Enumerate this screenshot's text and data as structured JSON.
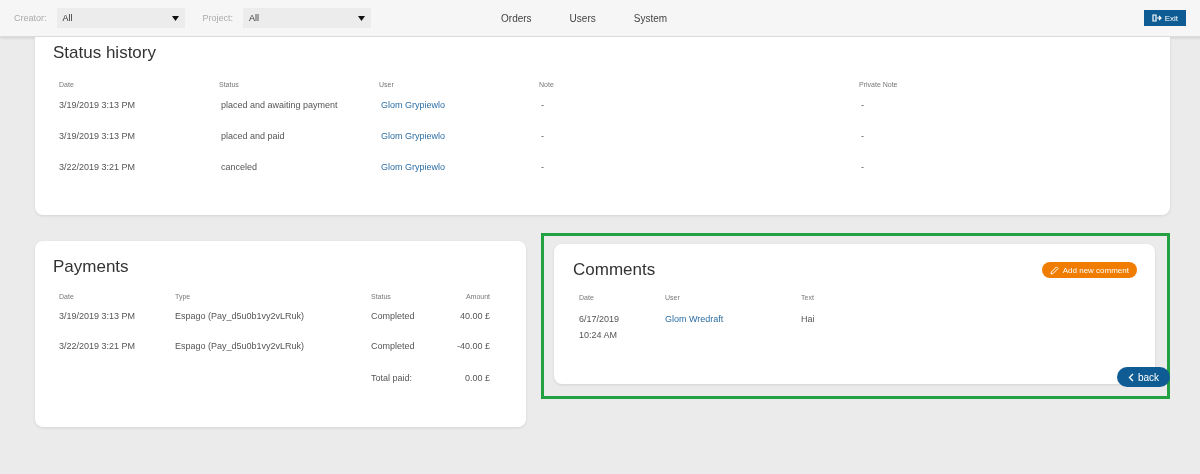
{
  "topbar": {
    "filters": [
      {
        "label": "Creator:",
        "value": "All"
      },
      {
        "label": "Project:",
        "value": "All"
      }
    ],
    "nav": [
      "Orders",
      "Users",
      "System"
    ],
    "exit_button": "Exit"
  },
  "status_history": {
    "title": "Status history",
    "columns": [
      "Date",
      "Status",
      "User",
      "Note",
      "Private Note"
    ],
    "rows": [
      {
        "date": "3/19/2019 3:13 PM",
        "status": "placed and awaiting payment",
        "user": "Glom Grypiewlo",
        "note": "-",
        "private_note": "-"
      },
      {
        "date": "3/19/2019 3:13 PM",
        "status": "placed and paid",
        "user": "Glom Grypiewlo",
        "note": "-",
        "private_note": "-"
      },
      {
        "date": "3/22/2019 3:21 PM",
        "status": "canceled",
        "user": "Glom Grypiewlo",
        "note": "-",
        "private_note": "-"
      }
    ]
  },
  "payments": {
    "title": "Payments",
    "columns": [
      "Date",
      "Type",
      "Status",
      "Amount"
    ],
    "rows": [
      {
        "date": "3/19/2019 3:13 PM",
        "type": "Espago (Pay_d5u0b1vy2vLRuk)",
        "status": "Completed",
        "amount": "40.00 £"
      },
      {
        "date": "3/22/2019 3:21 PM",
        "type": "Espago (Pay_d5u0b1vy2vLRuk)",
        "status": "Completed",
        "amount": "-40.00 £"
      }
    ],
    "total_label": "Total paid:",
    "total": "0.00 £"
  },
  "comments": {
    "title": "Comments",
    "highlighted": true,
    "add_button": "Add new comment",
    "columns": [
      "Date",
      "User",
      "Text"
    ],
    "rows": [
      {
        "date": "6/17/2019",
        "time": "10:24 AM",
        "user": "Glom Wredraft",
        "text": "Hai"
      }
    ]
  },
  "back_button": "back"
}
